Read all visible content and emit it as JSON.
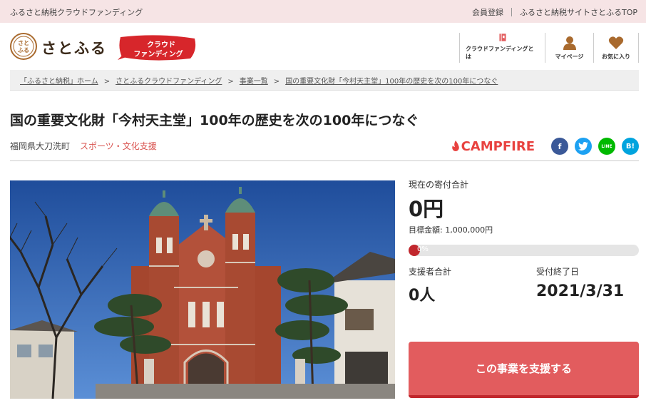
{
  "topbar": {
    "lead": "ふるさと納税クラウドファンディング",
    "register": "会員登録",
    "top_link": "ふるさと納税サイトさとふるTOP"
  },
  "header": {
    "logo_text": "さとふる",
    "logo_mark_text": "さとふる",
    "cf_badge_line1": "クラウド",
    "cf_badge_line2": "ファンディング",
    "nav": [
      {
        "label": "クラウドファンディングとは",
        "icon": "book-icon"
      },
      {
        "label": "マイページ",
        "icon": "user-icon"
      },
      {
        "label": "お気に入り",
        "icon": "heart-icon"
      }
    ]
  },
  "breadcrumb": [
    "「ふるさと納税」ホーム",
    "さとふるクラウドファンディング",
    "事業一覧",
    "国の重要文化財「今村天主堂」100年の歴史を次の100年につなぐ"
  ],
  "project": {
    "title": "国の重要文化財「今村天主堂」100年の歴史を次の100年につなぐ",
    "location": "福岡県大刀洗町",
    "category": "スポーツ・文化支援"
  },
  "share": {
    "campfire": "CAMPFIRE",
    "buttons": [
      {
        "name": "facebook-share-button",
        "glyph": "f",
        "color": "#3b5998"
      },
      {
        "name": "twitter-share-button",
        "glyph": "t",
        "color": "#1da1f2"
      },
      {
        "name": "line-share-button",
        "glyph": "LINE",
        "color": "#00b900"
      },
      {
        "name": "hatena-share-button",
        "glyph": "B!",
        "color": "#00a4de"
      }
    ]
  },
  "stats": {
    "current_label": "現在の寄付合計",
    "current_amount": "0円",
    "target": "目標金額: 1,000,000円",
    "progress_text": "0%",
    "progress_fraction": 0,
    "supporters_label": "支援者合計",
    "supporters_value": "0人",
    "deadline_label": "受付終了日",
    "deadline_value": "2021/3/31"
  },
  "cta": {
    "label": "この事業を支援する"
  },
  "colors": {
    "accent": "#e25c5e",
    "accent_dark": "#c1272d",
    "topbar_bg": "#f6e4e5"
  }
}
